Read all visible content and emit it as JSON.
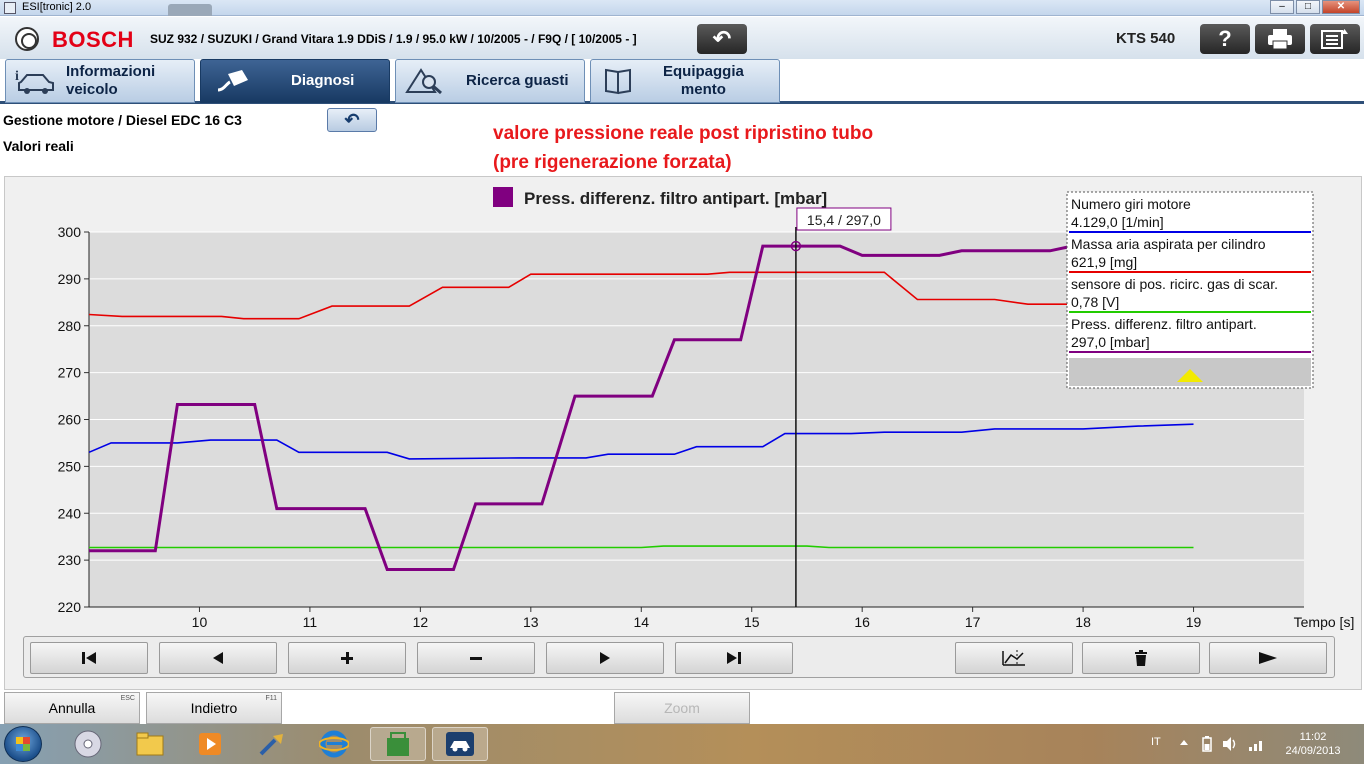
{
  "window": {
    "title": "ESI[tronic] 2.0",
    "controls": [
      "minimize",
      "maximize",
      "close"
    ]
  },
  "header": {
    "brand": "BOSCH",
    "vehicle": "SUZ 932 / SUZUKI / Grand Vitara 1.9 DDiS / 1.9 / 95.0 kW / 10/2005 - / F9Q / [ 10/2005 - ]",
    "back_symbol": "↶",
    "device": "KTS 540",
    "help_symbol": "?",
    "icons": [
      "bosch-logo-icon",
      "back-arrow-icon",
      "help-icon",
      "printer-icon",
      "menu-list-icon"
    ]
  },
  "tabs": [
    {
      "line1": "Informazioni",
      "line2": "veicolo",
      "icon": "car-info-icon"
    },
    {
      "line1": "Diagnosi",
      "line2": "",
      "icon": "diagnostic-plug-icon",
      "active": true
    },
    {
      "line1": "Ricerca guasti",
      "line2": "",
      "icon": "fault-search-icon"
    },
    {
      "line1": "Equipaggia",
      "line2": "mento",
      "icon": "book-icon"
    }
  ],
  "subheader": {
    "breadcrumb": "Gestione motore / Diesel EDC 16 C3",
    "title": "Valori reali",
    "back_symbol": "↶"
  },
  "annotation": {
    "line1": "valore pressione reale post ripristino tubo",
    "line2": "(pre rigenerazione forzata)",
    "color": "#e8191c"
  },
  "chart_data": {
    "type": "line",
    "title": "Press. differenz. filtro antipart. [mbar]",
    "title_marker_color": "#800080",
    "xlabel": "Tempo [s]",
    "ylabel": "",
    "xlim": [
      9.0,
      20.0
    ],
    "ylim": [
      220,
      300
    ],
    "xticks": [
      10,
      11,
      12,
      13,
      14,
      15,
      16,
      17,
      18,
      19
    ],
    "yticks": [
      220,
      230,
      240,
      250,
      260,
      270,
      280,
      290,
      300
    ],
    "grid": true,
    "cursor": {
      "x": 15.4,
      "label": "15,4 / 297,0",
      "marker_y": 297.0
    },
    "series": [
      {
        "name": "Numero giri motore",
        "color": "#0000e6",
        "x": [
          9.0,
          9.2,
          9.8,
          10.1,
          10.7,
          10.9,
          11.7,
          11.9,
          12.9,
          13.5,
          13.7,
          14.3,
          14.5,
          15.1,
          15.3,
          15.9,
          16.2,
          16.9,
          17.2,
          18.0,
          18.5,
          19.0
        ],
        "values": [
          253.0,
          255.0,
          255.0,
          255.6,
          255.6,
          253.0,
          253.0,
          251.6,
          251.8,
          251.8,
          252.6,
          252.6,
          254.2,
          254.2,
          257.0,
          257.0,
          257.3,
          257.3,
          258.0,
          258.0,
          258.6,
          259.0
        ]
      },
      {
        "name": "Massa aria aspirata per cilindro",
        "color": "#e60000",
        "x": [
          9.0,
          9.3,
          10.2,
          10.4,
          10.9,
          11.2,
          11.9,
          12.2,
          12.8,
          13.0,
          14.6,
          14.8,
          16.2,
          16.5,
          17.2,
          17.5,
          18.4,
          18.7
        ],
        "values": [
          282.4,
          282.0,
          282.0,
          281.5,
          281.5,
          284.2,
          284.2,
          288.2,
          288.2,
          291.0,
          291.0,
          291.4,
          291.4,
          285.6,
          285.6,
          284.6,
          284.6,
          284.6
        ]
      },
      {
        "name": "sensore di pos. ricirc. gas di scar.",
        "color": "#22cc00",
        "x": [
          9.0,
          14.0,
          14.2,
          15.5,
          15.7,
          19.0
        ],
        "values": [
          232.7,
          232.7,
          233.0,
          233.0,
          232.7,
          232.7
        ]
      },
      {
        "name": "Press. differenz. filtro antipart.",
        "color": "#800080",
        "x": [
          9.0,
          9.6,
          9.8,
          10.5,
          10.7,
          11.5,
          11.7,
          12.3,
          12.5,
          13.1,
          13.4,
          14.1,
          14.3,
          14.9,
          15.1,
          15.8,
          16.0,
          16.7,
          16.9,
          17.7,
          17.9
        ],
        "values": [
          232.0,
          232.0,
          263.2,
          263.2,
          241.0,
          241.0,
          228.0,
          228.0,
          242.0,
          242.0,
          265.0,
          265.0,
          277.0,
          277.0,
          297.0,
          297.0,
          295.0,
          295.0,
          296.0,
          296.0,
          297.0
        ]
      }
    ]
  },
  "legend_panel": {
    "items": [
      {
        "name": "Numero giri motore",
        "value": "4.129,0 [1/min]",
        "color": "#0000e6"
      },
      {
        "name": "Massa aria aspirata per cilindro",
        "value": "621,9 [mg]",
        "color": "#e60000"
      },
      {
        "name": "sensore di pos. ricirc. gas di scar.",
        "value": "0,78 [V]",
        "color": "#22cc00"
      },
      {
        "name": "Press. differenz. filtro antipart.",
        "value": "297,0 [mbar]",
        "color": "#800080"
      }
    ],
    "scroll_icon": "triangle-up-icon"
  },
  "controls": {
    "buttons": [
      {
        "name": "go-first-button",
        "icon": "skip-first-icon"
      },
      {
        "name": "step-back-button",
        "icon": "play-reverse-icon"
      },
      {
        "name": "zoom-in-button",
        "icon": "plus-icon"
      },
      {
        "name": "zoom-out-button",
        "icon": "minus-icon"
      },
      {
        "name": "step-forward-button",
        "icon": "play-icon"
      },
      {
        "name": "go-last-button",
        "icon": "skip-last-icon"
      },
      {
        "name": "trigger-button",
        "icon": "trigger-icon"
      },
      {
        "name": "delete-button",
        "icon": "trash-icon"
      },
      {
        "name": "run-button",
        "icon": "play-icon"
      }
    ]
  },
  "footer": {
    "cancel_label": "Annulla",
    "cancel_key": "ESC",
    "back_label": "Indietro",
    "back_key": "F11",
    "zoom_label": "Zoom"
  },
  "taskbar": {
    "items": [
      "media-disc-icon",
      "file-explorer-icon",
      "media-player-icon",
      "tools-icon",
      "internet-explorer-icon",
      "store-icon",
      "esitronic-icon"
    ],
    "language": "IT",
    "time": "11:02",
    "date": "24/09/2013"
  }
}
